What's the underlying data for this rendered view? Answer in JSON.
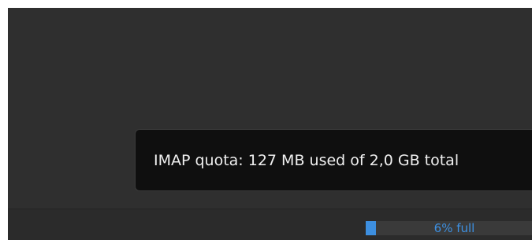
{
  "tooltip": {
    "text": "IMAP quota: 127 MB used of 2,0 GB total"
  },
  "statusbar": {
    "quota": {
      "label": "6% full",
      "fraction": 0.06
    }
  },
  "colors": {
    "background": "#2f2f2f",
    "tooltip_bg": "#0f0f0f",
    "accent": "#3d8fe0"
  }
}
